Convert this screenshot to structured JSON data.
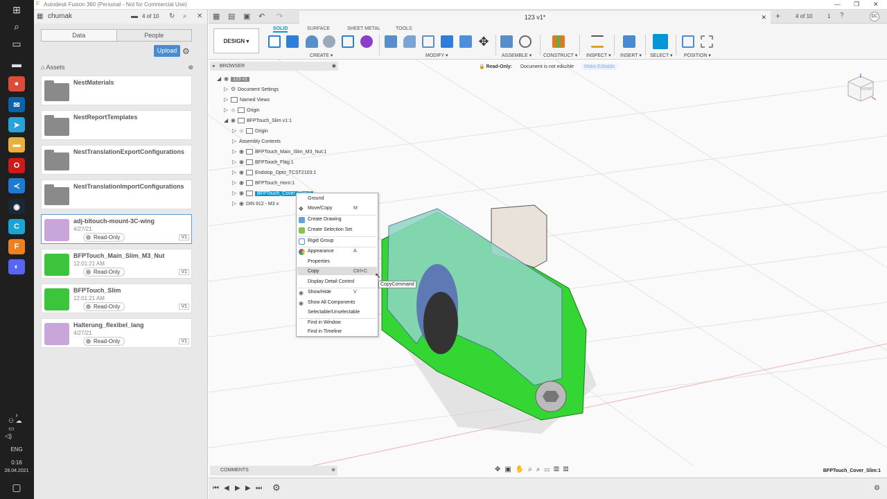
{
  "window": {
    "title": "Autodesk Fusion 360 (Personal - Not for Commercial Use)"
  },
  "taskbar": {
    "lang": "ENG",
    "time": "0:16",
    "date": "28.04.2021"
  },
  "data_panel": {
    "user": "chumak",
    "counter": "4 of 10",
    "tabs": [
      "Data",
      "People"
    ],
    "upload_label": "Upload",
    "breadcrumb": "Assets",
    "folders": [
      "NestMaterials",
      "NestReportTemplates",
      "NestTranslationExportConfigurations",
      "NestTranslationImportConfigurations"
    ],
    "files": [
      {
        "name": "adj-bltouch-mount-3C-wing",
        "date": "4/27/21",
        "status": "Read-Only",
        "version": "V1",
        "color": "#c9a6d9"
      },
      {
        "name": "BFPTouch_Main_Slim_M3_Nut",
        "date": "12:01:21 AM",
        "status": "Read-Only",
        "version": "V1",
        "color": "#3cc43c"
      },
      {
        "name": "BFPTouch_Slim",
        "date": "12:01:21 AM",
        "status": "Read-Only",
        "version": "V1",
        "color": "#3cc43c"
      },
      {
        "name": "Halterung_flexibel_lang",
        "date": "4/27/21",
        "status": "Read-Only",
        "version": "V1",
        "color": "#c9a6d9"
      }
    ]
  },
  "document": {
    "tab_title": "123 v1*",
    "counter": "4 of 10",
    "jobs": "1",
    "user_initials": "DC"
  },
  "ribbon": {
    "workspace": "DESIGN",
    "tabs": [
      "SOLID",
      "SURFACE",
      "SHEET METAL",
      "TOOLS"
    ],
    "groups": [
      "CREATE",
      "MODIFY",
      "ASSEMBLE",
      "CONSTRUCT",
      "INSPECT",
      "INSERT",
      "SELECT",
      "POSITION"
    ]
  },
  "notice": {
    "label": "Read-Only:",
    "text": "Document is not editable",
    "action": "Make Editable"
  },
  "browser": {
    "title": "BROWSER",
    "root": "123 v1",
    "items": [
      "Document Settings",
      "Named Views",
      "Origin",
      "BFPTouch_Slim v1:1",
      "Origin",
      "Assembly Contexts",
      "BFPTouch_Main_Slim_M3_Nut:1",
      "BFPTouch_Flag:1",
      "Endstop_Opto_TCST2103:1",
      "BFPTouch_Horn:1",
      "BFPTouch_Cover_Slim:1",
      "DIN 912 - M3 x"
    ]
  },
  "context_menu": {
    "items": [
      "Ground",
      "Move/Copy",
      "Create Drawing",
      "Create Selection Set",
      "Rigid Group",
      "Appearance",
      "Properties",
      "Copy",
      "Display Detail Control",
      "Show/Hide",
      "Show All Components",
      "Selectable/Unselectable",
      "Find in Window",
      "Find in Timeline"
    ],
    "shortcuts": {
      "move": "M",
      "appearance": "A",
      "copy": "Ctrl+C",
      "show": "V"
    },
    "tooltip": "CopyCommand"
  },
  "viewcube": {
    "front": "FRONT",
    "top": "TOP",
    "right": "RIGHT"
  },
  "comments": "COMMENTS",
  "status_selection": "BFPTouch_Cover_Slim:1"
}
